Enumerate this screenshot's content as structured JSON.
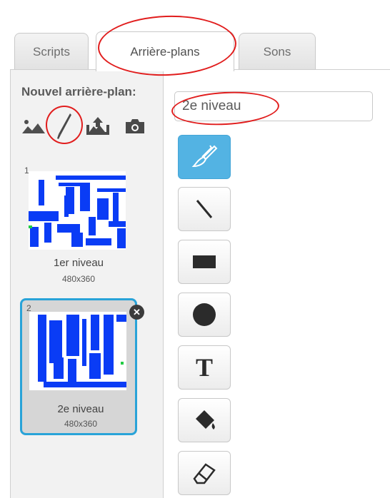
{
  "tabs": [
    {
      "label": "Scripts",
      "active": false
    },
    {
      "label": "Arrière-plans",
      "active": true
    },
    {
      "label": "Sons",
      "active": false
    }
  ],
  "new_backdrop": {
    "label": "Nouvel arrière-plan:",
    "icons": [
      "landscape-library-icon",
      "paintbrush-icon",
      "upload-icon",
      "camera-icon"
    ]
  },
  "backdrop_name_value": "2e niveau",
  "backdrops": [
    {
      "number": "1",
      "name": "1er niveau",
      "size": "480x360",
      "selected": false
    },
    {
      "number": "2",
      "name": "2e niveau",
      "size": "480x360",
      "selected": true
    }
  ],
  "tools": [
    "brush-tool-icon",
    "line-tool-icon",
    "rectangle-tool-icon",
    "ellipse-tool-icon",
    "text-tool-icon",
    "fill-tool-icon",
    "eraser-tool-icon"
  ],
  "tool_text_glyph": "T",
  "delete_glyph": "✕",
  "colors": {
    "accent": "#29a3d8",
    "active_tool": "#53b3e3",
    "maze": "#0a3cf5",
    "annotation": "#e11d1d"
  }
}
